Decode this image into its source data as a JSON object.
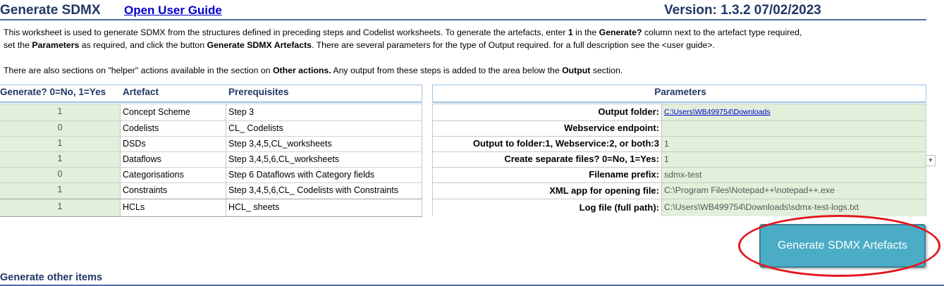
{
  "header": {
    "title": "Generate SDMX",
    "guide_link": "Open User Guide",
    "version": "Version: 1.3.2 07/02/2023"
  },
  "description": {
    "line1_a": "This worksheet is used to generate SDMX from the structures defined in preceding steps and Codelist worksheets. To generate the artefacts, enter ",
    "line1_b": "1",
    "line1_c": " in the ",
    "line1_d": "Generate?",
    "line1_e": " column next to the artefact type required,",
    "line2_a": "set the ",
    "line2_b": "Parameters",
    "line2_c": " as required, and click the button ",
    "line2_d": "Generate SDMX Artefacts",
    "line2_e": ". There are several parameters for the type of Output required. for a full description see the <user guide>.",
    "line3_a": "There are also sections on  \"helper\" actions available in the section on ",
    "line3_b": "Other actions.",
    "line3_c": " Any output from these steps is added to the area below the ",
    "line3_d": "Output",
    "line3_e": " section."
  },
  "artefacts": {
    "headers": {
      "generate": "Generate? 0=No, 1=Yes",
      "artefact": "Artefact",
      "prereq": "Prerequisites"
    },
    "rows": [
      {
        "generate": "1",
        "artefact": "Concept Scheme",
        "prereq": "Step 3"
      },
      {
        "generate": "0",
        "artefact": "Codelists",
        "prereq": "CL_ Codelists"
      },
      {
        "generate": "1",
        "artefact": "DSDs",
        "prereq": "Step 3,4,5,CL_worksheets"
      },
      {
        "generate": "1",
        "artefact": "Dataflows",
        "prereq": "Step 3,4,5,6,CL_worksheets"
      },
      {
        "generate": "0",
        "artefact": "Categorisations",
        "prereq": "Step 6 Dataflows with Category fields"
      },
      {
        "generate": "1",
        "artefact": "Constraints",
        "prereq": "Step 3,4,5,6,CL_ Codelists with Constraints"
      },
      {
        "generate": "1",
        "artefact": "HCLs",
        "prereq": "HCL_ sheets"
      }
    ]
  },
  "parameters": {
    "header": "Parameters",
    "rows": [
      {
        "label": "Output folder:",
        "value": "C:\\Users\\WB499754\\Downloads"
      },
      {
        "label": "Webservice endpoint:",
        "value": ""
      },
      {
        "label": "Output to folder:1, Webservice:2, or both:3",
        "value": "1"
      },
      {
        "label": "Create separate files? 0=No, 1=Yes:",
        "value": "1"
      },
      {
        "label": "Filename prefix:",
        "value": "sdmx-test"
      },
      {
        "label": "XML app for opening file:",
        "value": "C:\\Program Files\\Notepad++\\notepad++.exe"
      },
      {
        "label": "Log file (full path):",
        "value": "C:\\Users\\WB499754\\Downloads\\sdmx-test-logs.txt"
      }
    ]
  },
  "button": {
    "label": "Generate SDMX Artefacts"
  },
  "other": {
    "title": "Generate other items"
  },
  "icons": {
    "dropdown": "chevron-down-icon"
  },
  "colors": {
    "title": "#1f3864",
    "input_fill": "#e2efda",
    "button": "#4bacc6",
    "annotation": "#e4161b"
  }
}
